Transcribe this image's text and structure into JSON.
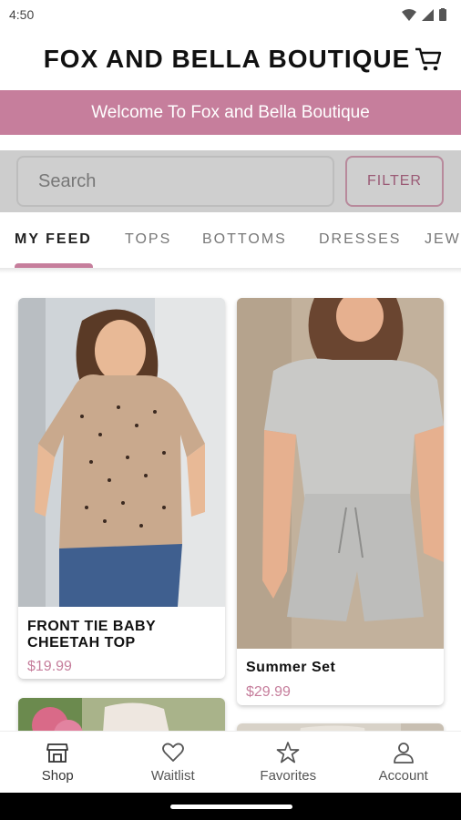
{
  "status": {
    "time": "4:50"
  },
  "header": {
    "title": "FOX AND BELLA BOUTIQUE"
  },
  "banner": {
    "text": "Welcome To Fox and Bella Boutique"
  },
  "search": {
    "placeholder": "Search",
    "filter_label": "FILTER"
  },
  "tabs": [
    {
      "label": "MY FEED",
      "active": true
    },
    {
      "label": "TOPS",
      "active": false
    },
    {
      "label": "BOTTOMS",
      "active": false
    },
    {
      "label": "DRESSES",
      "active": false
    },
    {
      "label": "JEW",
      "active": false
    }
  ],
  "products": [
    {
      "name": "FRONT TIE BABY CHEETAH TOP",
      "price": "$19.99"
    },
    {
      "name": "Summer Set",
      "price": "$29.99"
    }
  ],
  "nav": [
    {
      "label": "Shop",
      "icon": "shop-icon"
    },
    {
      "label": "Waitlist",
      "icon": "heart-icon"
    },
    {
      "label": "Favorites",
      "icon": "star-icon"
    },
    {
      "label": "Account",
      "icon": "account-icon"
    }
  ],
  "colors": {
    "accent": "#c67e9c",
    "search_bg": "#cdcdcd"
  }
}
